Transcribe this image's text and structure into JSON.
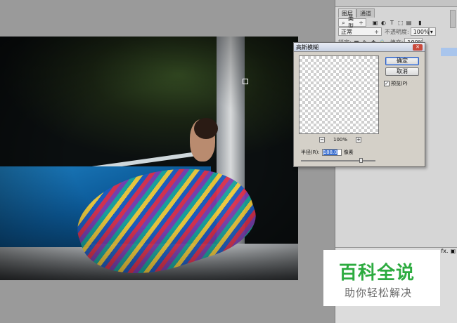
{
  "panel": {
    "tabs": [
      "图层",
      "通道"
    ],
    "filter_kind": "类型",
    "filter_icons": [
      "image-filter-icon",
      "adjustment-filter-icon",
      "type-filter-icon",
      "shape-filter-icon",
      "smart-object-filter-icon"
    ],
    "blend_mode": "正常",
    "opacity_label": "不透明度:",
    "opacity_value": "100%",
    "lock_label": "锁定:",
    "fill_label": "填充:",
    "fill_value": "100%",
    "lower_buttons": [
      "fx-icon",
      "trash-icon"
    ]
  },
  "dialog": {
    "title": "高斯模糊",
    "ok": "确定",
    "cancel": "取消",
    "preview_label": "预览(P)",
    "zoom": "100%",
    "radius_label": "半径(R):",
    "radius_value": "188.0",
    "radius_unit": "像素"
  },
  "watermark": {
    "title": "百科全说",
    "subtitle": "助你轻松解决"
  }
}
